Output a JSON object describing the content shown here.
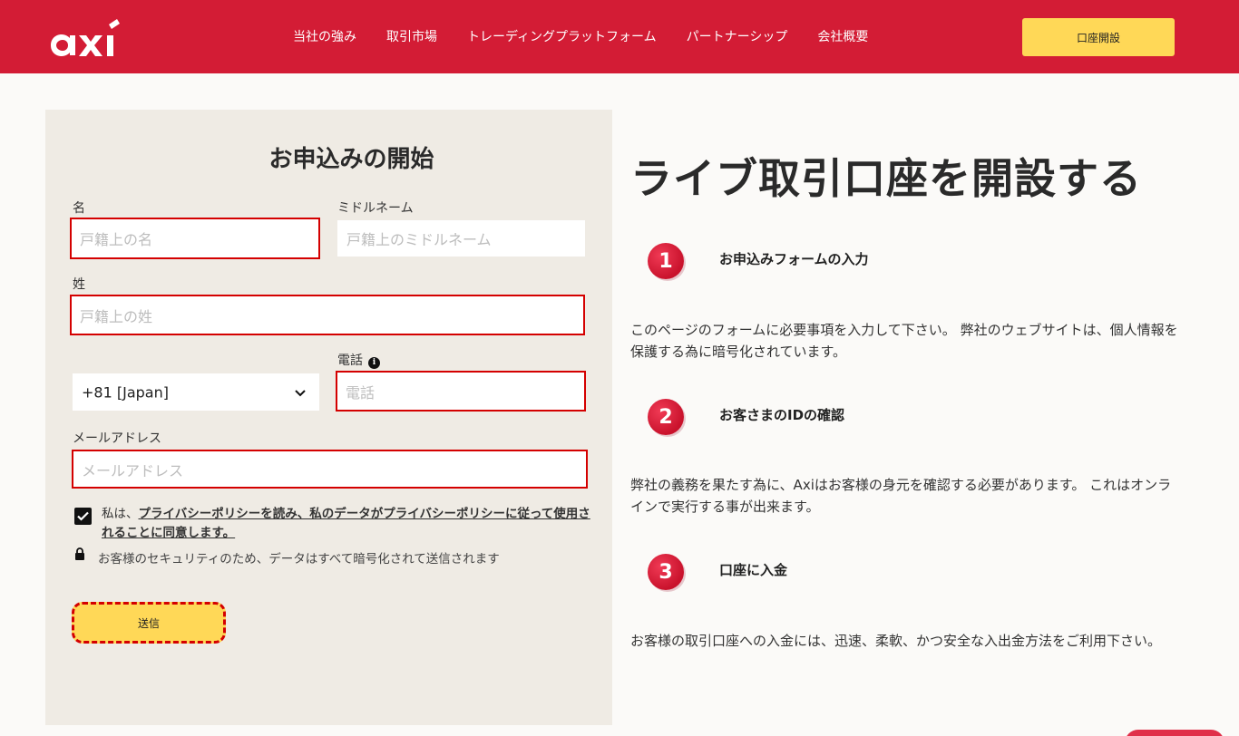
{
  "header": {
    "logo": "axi",
    "nav": [
      "当社の強み",
      "取引市場",
      "トレーディングプラットフォーム",
      "パートナーシップ",
      "会社概要"
    ],
    "cta": "口座開設"
  },
  "form": {
    "title": "お申込みの開始",
    "first_name": {
      "label": "名",
      "placeholder": "戸籍上の名"
    },
    "middle_name": {
      "label": "ミドルネーム",
      "placeholder": "戸籍上のミドルネーム"
    },
    "last_name": {
      "label": "姓",
      "placeholder": "戸籍上の姓"
    },
    "phone": {
      "label": "電話",
      "placeholder": "電話",
      "country_code": "+81 [Japan]",
      "info_icon": "info-icon"
    },
    "email": {
      "label": "メールアドレス",
      "placeholder": "メールアドレス"
    },
    "consent": {
      "prefix": "私は、",
      "link_text": "プライバシーポリシーを読み、私のデータがプライバシーポリシーに従って使用されることに同意します。",
      "checked": true
    },
    "security_note": "お客様のセキュリティのため、データはすべて暗号化されて送信されます",
    "submit": "送信"
  },
  "hero": {
    "title": "ライブ取引口座を開設する"
  },
  "steps": [
    {
      "num": "1",
      "title": "お申込みフォームの入力",
      "text": "このページのフォームに必要事項を入力して下さい。 弊社のウェブサイトは、個人情報を保護する為に暗号化されています。"
    },
    {
      "num": "2",
      "title": "お客さまのIDの確認",
      "text": "弊社の義務を果たす為に、Axiはお客様の身元を確認する必要があります。 これはオンラインで実行する事が出来ます。"
    },
    {
      "num": "3",
      "title": "口座に入金",
      "text": "お客様の取引口座への入金には、迅速、柔軟、かつ安全な入出金方法をご利用下さい。"
    }
  ],
  "colors": {
    "brand_red": "#d31c35",
    "cta_yellow": "#ffd857",
    "panel_bg": "#efebe4",
    "error_border": "#d40000"
  }
}
